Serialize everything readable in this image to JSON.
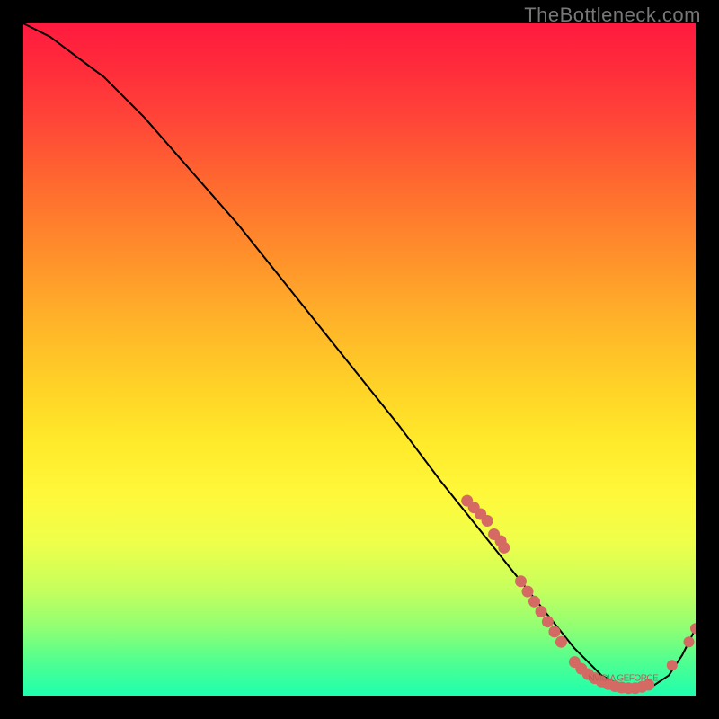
{
  "watermark": "TheBottleneck.com",
  "chart_data": {
    "type": "line",
    "title": "",
    "xlabel": "",
    "ylabel": "",
    "xlim": [
      0,
      100
    ],
    "ylim": [
      0,
      100
    ],
    "grid": false,
    "series": [
      {
        "name": "bottleneck-curve",
        "x": [
          0,
          4,
          8,
          12,
          18,
          25,
          32,
          40,
          48,
          56,
          62,
          66,
          70,
          74,
          78,
          82,
          86,
          90,
          93,
          96,
          98,
          100
        ],
        "y": [
          100,
          98,
          95,
          92,
          86,
          78,
          70,
          60,
          50,
          40,
          32,
          27,
          22,
          17,
          12,
          7,
          3,
          1,
          1,
          3,
          6,
          10
        ]
      }
    ],
    "scatter_clusters": [
      {
        "name": "upper-cluster",
        "points": [
          [
            66,
            29
          ],
          [
            67,
            28
          ],
          [
            68,
            27
          ],
          [
            69,
            26
          ],
          [
            70,
            24
          ],
          [
            71,
            23
          ],
          [
            71.5,
            22
          ]
        ]
      },
      {
        "name": "lower-cluster",
        "points": [
          [
            74,
            17
          ],
          [
            75,
            15.5
          ],
          [
            76,
            14
          ],
          [
            77,
            12.5
          ],
          [
            78,
            11
          ],
          [
            79,
            9.5
          ],
          [
            80,
            8
          ]
        ]
      },
      {
        "name": "valley-cluster",
        "points": [
          [
            82,
            5
          ],
          [
            83,
            4
          ],
          [
            84,
            3.2
          ],
          [
            85,
            2.6
          ],
          [
            86,
            2.1
          ],
          [
            87,
            1.7
          ],
          [
            88,
            1.4
          ],
          [
            89,
            1.2
          ],
          [
            90,
            1.1
          ],
          [
            91,
            1.1
          ],
          [
            92,
            1.3
          ],
          [
            93,
            1.6
          ]
        ]
      },
      {
        "name": "tail-cluster",
        "points": [
          [
            96.5,
            4.5
          ],
          [
            99,
            8
          ],
          [
            100,
            10
          ]
        ]
      }
    ],
    "valley_label": "NVIDIA GEFORCE",
    "colors": {
      "curve": "#000000",
      "points": "#d46a63",
      "label": "#b85f58"
    }
  }
}
